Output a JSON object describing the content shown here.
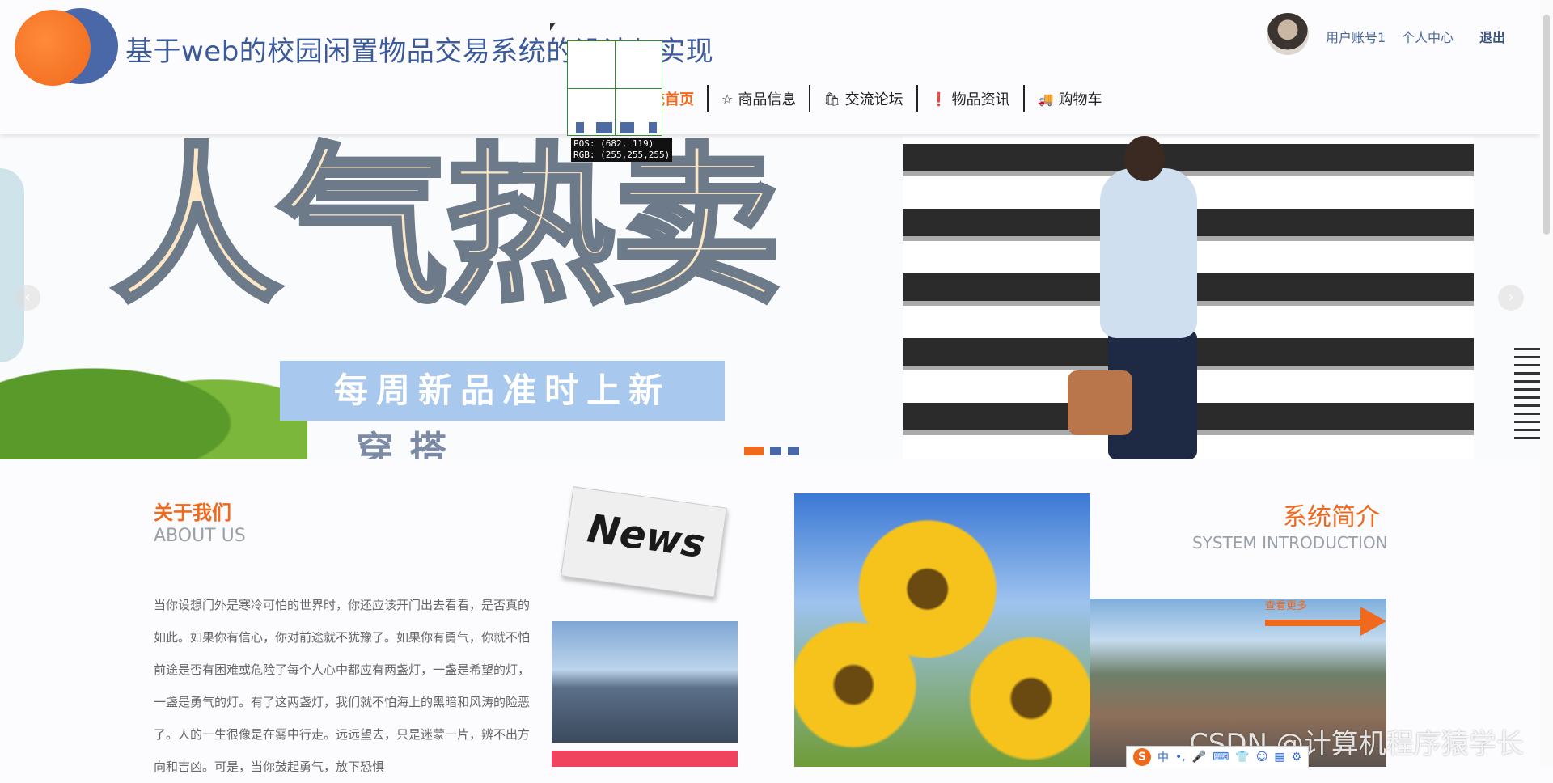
{
  "header": {
    "site_title": "基于web的校园闲置物品交易系统的设计与实现",
    "user_account": "用户账号1",
    "personal_center": "个人中心",
    "logout": "退出"
  },
  "nav": {
    "items": [
      {
        "label": "系统首页",
        "icon": "home-icon"
      },
      {
        "label": "商品信息",
        "icon": "star-icon"
      },
      {
        "label": "交流论坛",
        "icon": "bag-icon"
      },
      {
        "label": "物品资讯",
        "icon": "info-icon"
      },
      {
        "label": "购物车",
        "icon": "truck-icon"
      }
    ],
    "active_visible_text": "统首页"
  },
  "magnifier": {
    "pos": "POS: (682, 119)",
    "rgb": "RGB: (255,255,255)"
  },
  "banner": {
    "headline": "人气热卖",
    "subline": "每周新品准时上新",
    "subline2": "穿搭 "
  },
  "about": {
    "title": "关于我们",
    "subtitle": "ABOUT US",
    "text": "当你设想门外是寒冷可怕的世界时，你还应该开门出去看看，是否真的如此。如果你有信心，你对前途就不犹豫了。如果你有勇气，你就不怕前途是否有困难或危险了每个人心中都应有两盏灯，一盏是希望的灯，一盏是勇气的灯。有了这两盏灯，我们就不怕海上的黑暗和风涛的险恶了。人的一生很像是在雾中行走。远远望去，只是迷蒙一片，辨不出方向和吉凶。可是，当你鼓起勇气，放下恐惧",
    "news_label": "News"
  },
  "intro": {
    "title": "系统简介",
    "subtitle": "SYSTEM INTRODUCTION",
    "more": "查看更多"
  },
  "watermark": "CSDN @计算机程序猿学长",
  "ime": {
    "logo": "S",
    "items": [
      "中",
      "•,",
      "🎤",
      "⌨",
      "👕",
      "☺",
      "▦",
      "⚙"
    ]
  },
  "colors": {
    "accent": "#f0691c",
    "brand_blue": "#4a67a8"
  }
}
